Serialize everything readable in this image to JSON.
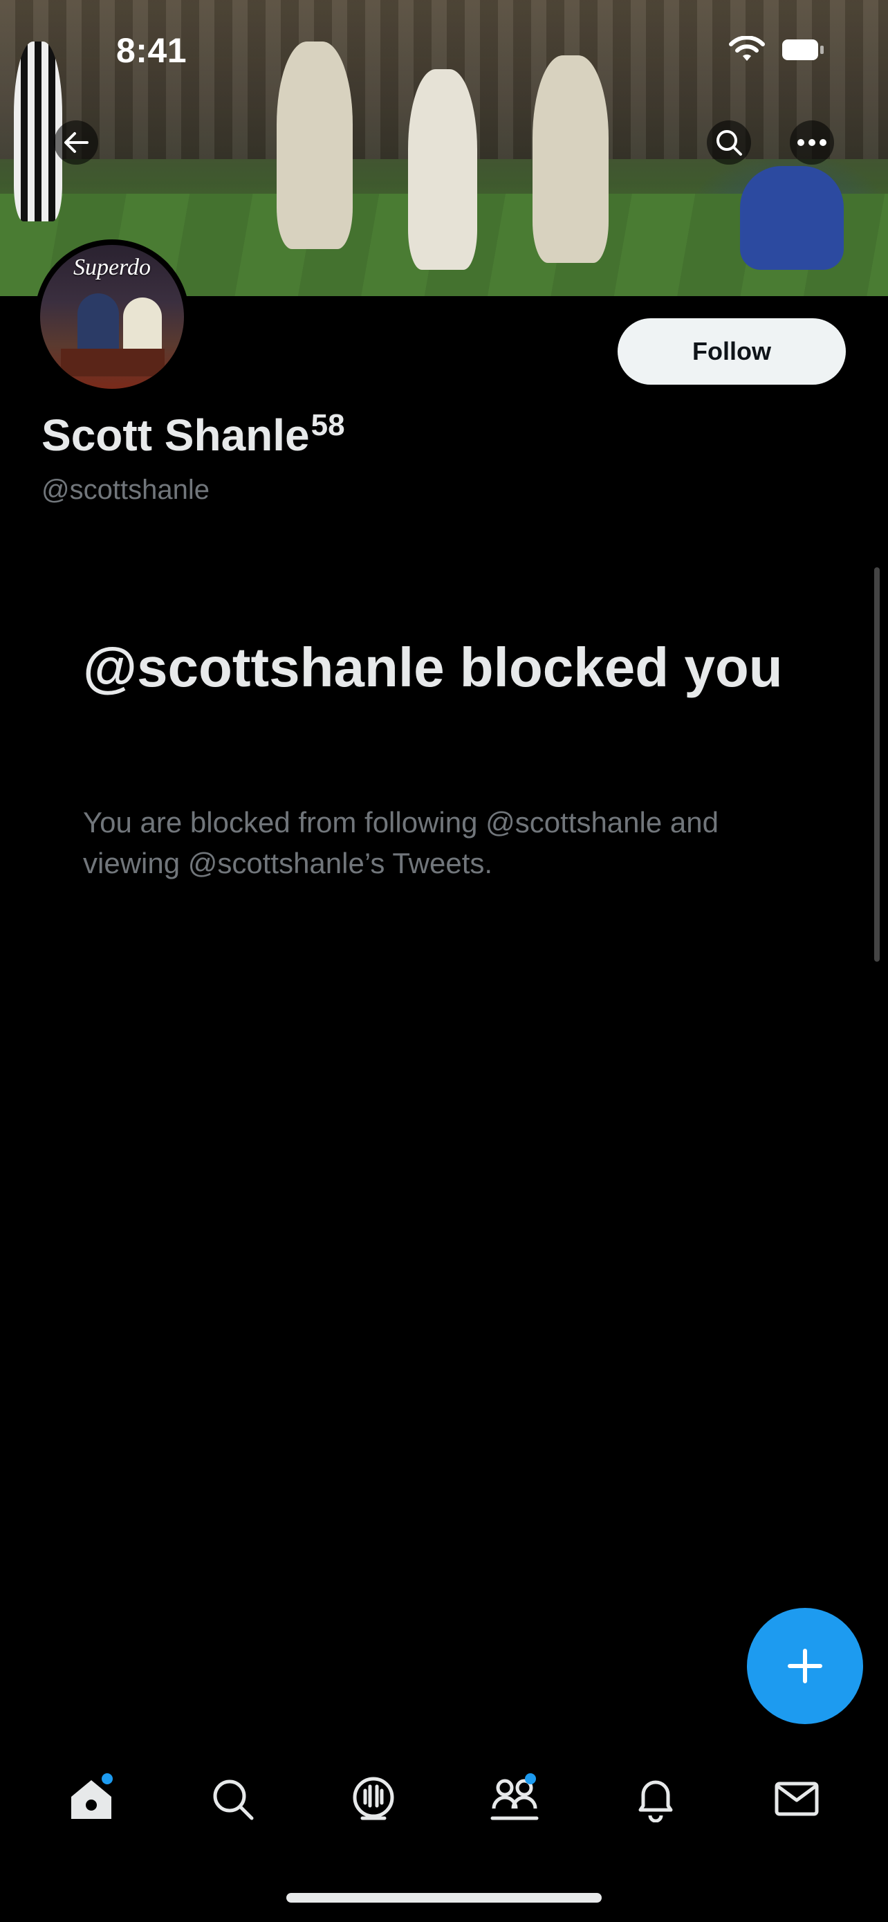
{
  "status_bar": {
    "time": "8:41"
  },
  "profile": {
    "display_name": "Scott Shanle",
    "name_superscript": "58",
    "handle": "@scottshanle",
    "follow_label": "Follow",
    "avatar_caption": "Superdo"
  },
  "blocked": {
    "title": "@scottshanle blocked you",
    "description": "You are blocked from following @scottshanle and viewing @scottshanle’s Tweets."
  },
  "colors": {
    "accent": "#1d9bf0",
    "background": "#000000",
    "primary_text": "#e7e9ea",
    "secondary_text": "#71767b"
  },
  "tabs": [
    {
      "icon": "home-icon",
      "badge": true
    },
    {
      "icon": "search-icon",
      "badge": false
    },
    {
      "icon": "spaces-icon",
      "badge": false
    },
    {
      "icon": "communities-icon",
      "badge": true
    },
    {
      "icon": "notifications-icon",
      "badge": false
    },
    {
      "icon": "messages-icon",
      "badge": false
    }
  ]
}
